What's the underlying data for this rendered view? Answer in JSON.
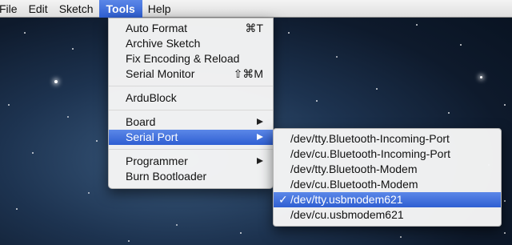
{
  "menubar": {
    "items": [
      "File",
      "Edit",
      "Sketch",
      "Tools",
      "Help"
    ],
    "active": "Tools"
  },
  "tools_menu": {
    "groups": [
      [
        {
          "label": "Auto Format",
          "shortcut": "⌘T"
        },
        {
          "label": "Archive Sketch"
        },
        {
          "label": "Fix Encoding & Reload"
        },
        {
          "label": "Serial Monitor",
          "shortcut": "⇧⌘M"
        }
      ],
      [
        {
          "label": "ArduBlock"
        }
      ],
      [
        {
          "label": "Board",
          "submenu": true
        },
        {
          "label": "Serial Port",
          "submenu": true,
          "highlighted": true
        }
      ],
      [
        {
          "label": "Programmer",
          "submenu": true
        },
        {
          "label": "Burn Bootloader"
        }
      ]
    ]
  },
  "serial_port_menu": {
    "items": [
      {
        "label": "/dev/tty.Bluetooth-Incoming-Port"
      },
      {
        "label": "/dev/cu.Bluetooth-Incoming-Port"
      },
      {
        "label": "/dev/tty.Bluetooth-Modem"
      },
      {
        "label": "/dev/cu.Bluetooth-Modem"
      },
      {
        "label": "/dev/tty.usbmodem621",
        "checked": true,
        "highlighted": true
      },
      {
        "label": "/dev/cu.usbmodem621"
      }
    ],
    "check_glyph": "✓"
  },
  "colors": {
    "highlight": "#3e6fdc",
    "menu_bg": "#f6f6f6"
  }
}
